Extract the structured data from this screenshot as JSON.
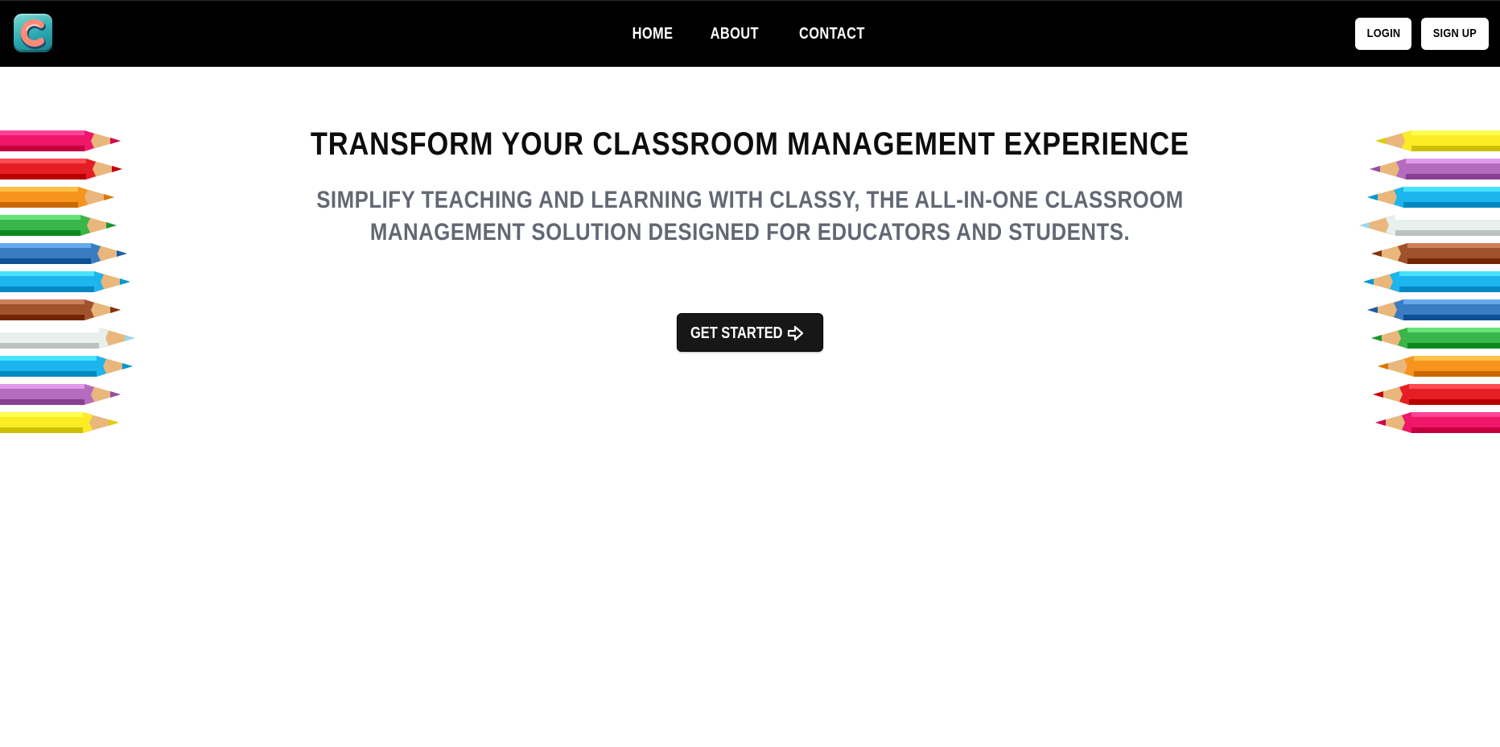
{
  "header": {
    "logo_icon": "classy-c-logo-icon",
    "nav": [
      {
        "label": "HOME"
      },
      {
        "label": "ABOUT"
      },
      {
        "label": "CONTACT"
      }
    ],
    "login_label": "LOGIN",
    "signup_label": "SIGN UP"
  },
  "hero": {
    "title": "TRANSFORM YOUR CLASSROOM MANAGEMENT EXPERIENCE",
    "subtitle": "SIMPLIFY TEACHING AND LEARNING WITH CLASSY, THE ALL-IN-ONE CLASSROOM MANAGEMENT SOLUTION DESIGNED FOR EDUCATORS AND STUDENTS.",
    "cta_label": "GET STARTED",
    "cta_icon": "arrow-right-icon"
  },
  "decor": {
    "left_pencil_colors": [
      "#f0166a",
      "#e51e25",
      "#f7941d",
      "#39b54a",
      "#3a7cc2",
      "#1cb5ee",
      "#a0522d",
      "#e8f0ee",
      "#1cb5ee",
      "#b56cc0",
      "#fbec25"
    ],
    "right_pencil_colors": [
      "#fbec25",
      "#b56cc0",
      "#1cb5ee",
      "#e8f0ee",
      "#a0522d",
      "#1cb5ee",
      "#3a7cc2",
      "#39b54a",
      "#f7941d",
      "#e51e25",
      "#f0166a"
    ]
  },
  "colors": {
    "topbar": "#000000",
    "title": "#0d0d0d",
    "subtitle": "#626873",
    "cta_bg": "#171717"
  }
}
